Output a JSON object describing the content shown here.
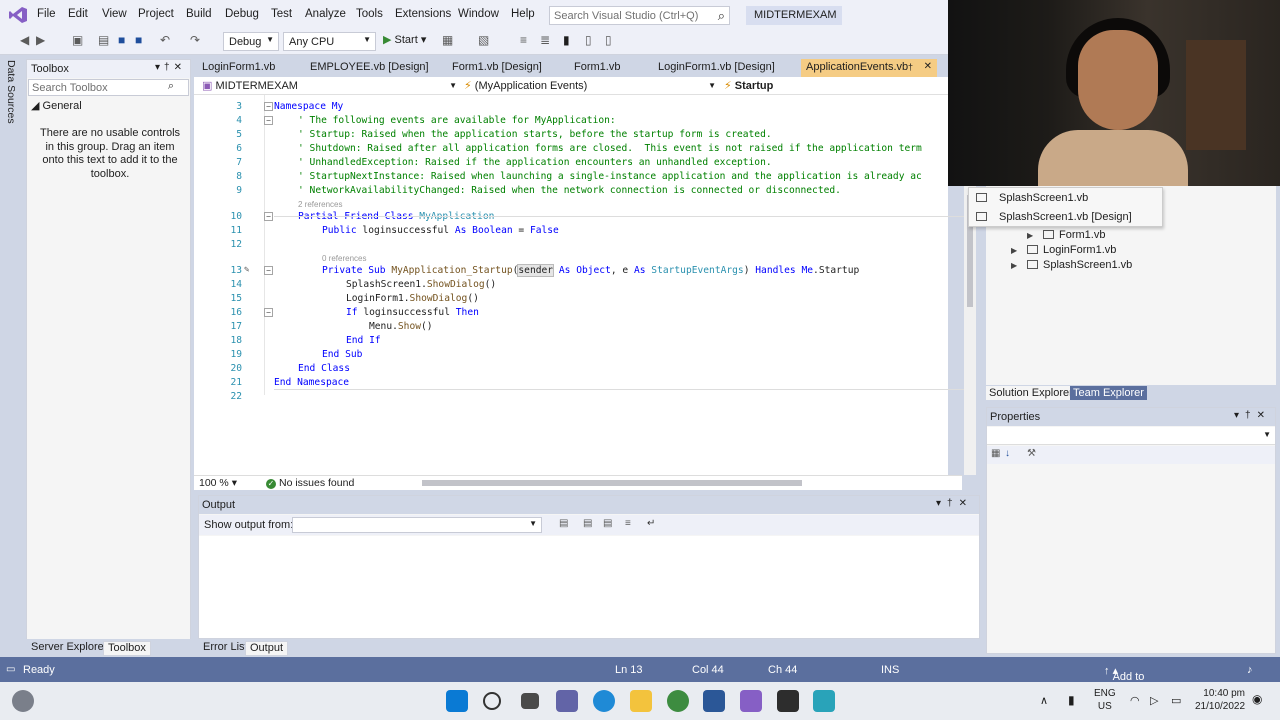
{
  "menubar": {
    "items": [
      "File",
      "Edit",
      "View",
      "Project",
      "Build",
      "Debug",
      "Test",
      "Analyze",
      "Tools",
      "Extensions",
      "Window",
      "Help"
    ],
    "search_placeholder": "Search Visual Studio (Ctrl+Q)",
    "solution_name": "MIDTERMEXAM"
  },
  "toolbar": {
    "config": "Debug",
    "platform": "Any CPU",
    "start_label": "Start"
  },
  "left_strip": {
    "label": "Data Sources"
  },
  "toolbox": {
    "title": "Toolbox",
    "search_placeholder": "Search Toolbox",
    "group": "General",
    "empty_text": "There are no usable controls in this group. Drag an item onto this text to add it to the toolbox.",
    "tabs": [
      "Server Explorer",
      "Toolbox"
    ]
  },
  "doc_tabs": [
    "LoginForm1.vb",
    "EMPLOYEE.vb [Design]",
    "Form1.vb [Design]",
    "Form1.vb",
    "LoginForm1.vb [Design]",
    "ApplicationEvents.vb"
  ],
  "navbar": {
    "project": "MIDTERMEXAM",
    "scope": "(MyApplication Events)",
    "member": "Startup"
  },
  "editor": {
    "lines": [
      {
        "n": "3",
        "t": "Namespace My"
      },
      {
        "n": "4",
        "t": "' The following events are available for MyApplication:"
      },
      {
        "n": "5",
        "t": "' Startup: Raised when the application starts, before the startup form is created."
      },
      {
        "n": "6",
        "t": "' Shutdown: Raised after all application forms are closed.  This event is not raised if the application term"
      },
      {
        "n": "7",
        "t": "' UnhandledException: Raised if the application encounters an unhandled exception."
      },
      {
        "n": "8",
        "t": "' StartupNextInstance: Raised when launching a single-instance application and the application is already ac"
      },
      {
        "n": "9",
        "t": "' NetworkAvailabilityChanged: Raised when the network connection is connected or disconnected."
      },
      {
        "n": "10",
        "t": "Partial Friend Class MyApplication"
      },
      {
        "n": "11",
        "t": "Public loginsuccessful As Boolean = False"
      },
      {
        "n": "12",
        "t": ""
      },
      {
        "n": "13",
        "t": "Private Sub MyApplication_Startup(sender As Object, e As StartupEventArgs) Handles Me.Startup"
      },
      {
        "n": "14",
        "t": "SplashScreen1.ShowDialog()"
      },
      {
        "n": "15",
        "t": "LoginForm1.ShowDialog()"
      },
      {
        "n": "16",
        "t": "If loginsuccessful Then"
      },
      {
        "n": "17",
        "t": "Menu.Show()"
      },
      {
        "n": "18",
        "t": "End If"
      },
      {
        "n": "19",
        "t": "End Sub"
      },
      {
        "n": "20",
        "t": "End Class"
      },
      {
        "n": "21",
        "t": "End Namespace"
      },
      {
        "n": "22",
        "t": ""
      }
    ],
    "refs_class": "2 references",
    "refs_sub": "0 references",
    "zoom": "100 %",
    "issues": "No issues found"
  },
  "output": {
    "title": "Output",
    "show_from_label": "Show output from:",
    "tabs": [
      "Error List",
      "Output"
    ]
  },
  "solution_explorer": {
    "popup_items": [
      "SplashScreen1.vb",
      "SplashScreen1.vb [Design]"
    ],
    "tree_items": [
      "Form1.vb",
      "LoginForm1.vb",
      "SplashScreen1.vb"
    ],
    "tabs": [
      "Solution Explorer",
      "Team Explorer"
    ]
  },
  "properties": {
    "title": "Properties"
  },
  "statusbar": {
    "ready": "Ready",
    "ln": "Ln 13",
    "col": "Col 44",
    "ch": "Ch 44",
    "ins": "INS",
    "source_control": "Add to Source Control"
  },
  "taskbar": {
    "lang": "ENG",
    "region": "US",
    "time": "10:40 pm",
    "date": "21/10/2022"
  },
  "colors": {
    "accent": "#5b6f9e",
    "active_tab": "#f5cc84",
    "comment": "#008000",
    "keyword": "#0000ff"
  }
}
